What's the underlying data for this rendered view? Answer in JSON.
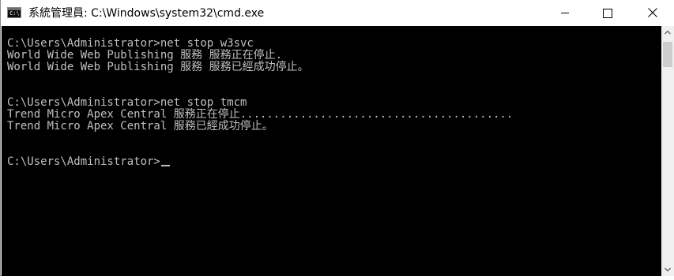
{
  "window": {
    "title": "系統管理員: C:\\Windows\\system32\\cmd.exe",
    "icon": "cmd-icon",
    "icon_prompt": "C:\\",
    "controls": {
      "minimize_icon": "minimize-icon",
      "maximize_icon": "maximize-icon",
      "close_icon": "close-icon"
    }
  },
  "console": {
    "lines": [
      "C:\\Users\\Administrator>net stop w3svc",
      "World Wide Web Publishing 服務 服務正在停止.",
      "World Wide Web Publishing 服務 服務已經成功停止。",
      "",
      "",
      "C:\\Users\\Administrator>net stop tmcm",
      "Trend Micro Apex Central 服務正在停止.........................................",
      "Trend Micro Apex Central 服務已經成功停止。",
      "",
      "",
      "C:\\Users\\Administrator>"
    ]
  },
  "scrollbar": {
    "up_icon": "chevron-up-icon",
    "down_icon": "chevron-down-icon"
  },
  "colors": {
    "console_bg": "#000000",
    "console_text": "#c0c0c0",
    "titlebar_bg": "#ffffff"
  }
}
